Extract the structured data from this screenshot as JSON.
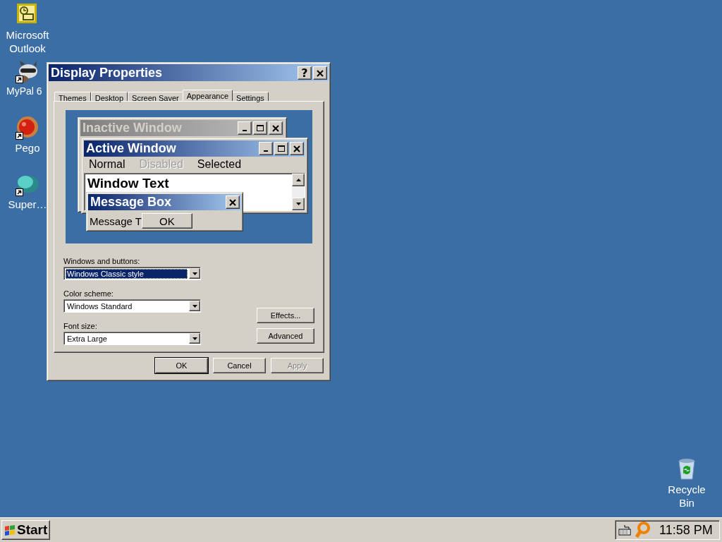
{
  "desktop_icons": [
    {
      "label": "Microsoft Outlook",
      "kind": "mail",
      "shortcut": false
    },
    {
      "label": "MyPal 6",
      "kind": "animal",
      "shortcut": true
    },
    {
      "label": "Pego",
      "kind": "ball",
      "shortcut": true
    },
    {
      "label": "Super…",
      "kind": "cloud",
      "shortcut": true
    }
  ],
  "recycle_bin": {
    "label": "Recycle Bin",
    "kind": "bin",
    "shortcut": false
  },
  "dialog": {
    "title": "Display Properties",
    "help_label": "?",
    "tabs": [
      {
        "label": "Themes",
        "selected": false
      },
      {
        "label": "Desktop",
        "selected": false
      },
      {
        "label": "Screen Saver",
        "selected": false
      },
      {
        "label": "Appearance",
        "selected": true
      },
      {
        "label": "Settings",
        "selected": false
      }
    ],
    "preview": {
      "inactive_title": "Inactive Window",
      "active_title": "Active Window",
      "menu_items": [
        {
          "label": "Normal",
          "disabled": false
        },
        {
          "label": "Disabled",
          "disabled": true
        },
        {
          "label": "Selected",
          "disabled": false
        }
      ],
      "window_text": "Window Text",
      "message_box_title": "Message Box",
      "message_text": "Message T",
      "ok_label": "OK"
    },
    "fields": [
      {
        "label": "Windows and buttons:",
        "value": "Windows Classic style",
        "selected": true
      },
      {
        "label": "Color scheme:",
        "value": "Windows Standard",
        "selected": false
      },
      {
        "label": "Font size:",
        "value": "Extra Large",
        "selected": false
      }
    ],
    "side_buttons": [
      "Effects...",
      "Advanced"
    ],
    "buttons": [
      {
        "label": "OK",
        "default": true,
        "disabled": false
      },
      {
        "label": "Cancel",
        "default": false,
        "disabled": false
      },
      {
        "label": "Apply",
        "default": false,
        "disabled": true
      }
    ]
  },
  "taskbar": {
    "start_label": "Start",
    "clock": "11:58 PM"
  }
}
